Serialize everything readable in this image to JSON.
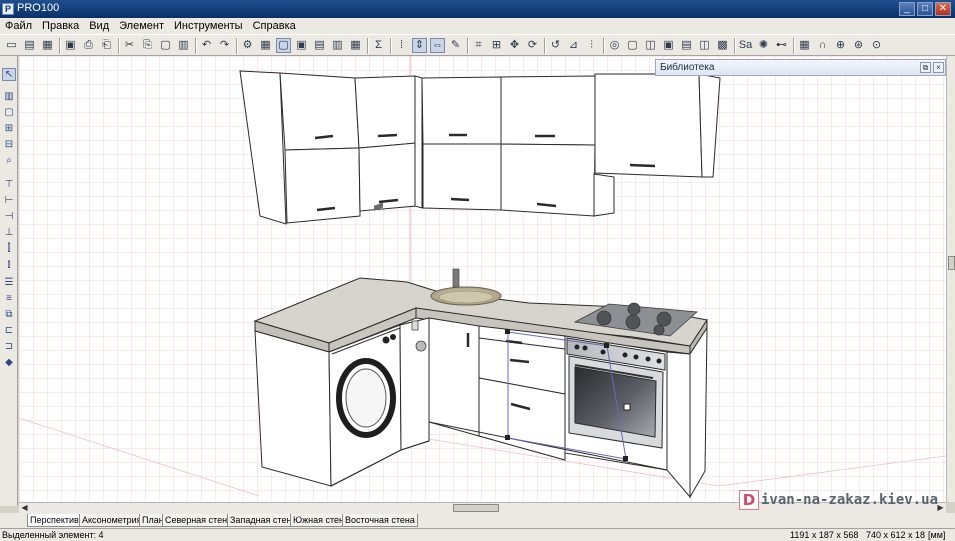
{
  "window": {
    "title": "PRO100",
    "app_icon": "pro100-app-icon"
  },
  "window_controls": {
    "minimize": "_",
    "maximize": "□",
    "close": "✕"
  },
  "menu": [
    "Файл",
    "Правка",
    "Вид",
    "Элемент",
    "Инструменты",
    "Справка"
  ],
  "toolbar_icons": [
    "new-icon",
    "open-icon",
    "save-icon",
    "export-icon",
    "print-icon",
    "print-preview-icon",
    "cut-icon",
    "copy-icon",
    "paste-icon",
    "clone-icon",
    "undo-icon",
    "redo-icon",
    "properties-icon",
    "sheet-icon",
    "view-mode-icon",
    "view-mode-2-icon",
    "view-mode-3-icon",
    "view-mode-4-icon",
    "view-mode-5-icon",
    "sum-icon",
    "snap-icon",
    "move-icon",
    "rotate-icon",
    "pen-icon",
    "frame-icon",
    "align-icon",
    "move-cross-icon",
    "rotate-axis-icon",
    "rotate-icon-2",
    "flip-icon",
    "mirror-icon",
    "target-icon",
    "cube-icon",
    "cube-2-icon",
    "cube-3-icon",
    "cube-4-icon",
    "cube-5-icon",
    "cube-6-icon",
    "texture-icon",
    "light-icon",
    "dimension-icon",
    "grid-icon",
    "magnet-icon",
    "render-icon",
    "lifebuoy-icon",
    "zoom-icon"
  ],
  "toolbar_glyphs": [
    "▭",
    "▤",
    "▦",
    "▣",
    "⎙",
    "⎗",
    "✂",
    "⎘",
    "▢",
    "▥",
    "↶",
    "↷",
    "⚙",
    "▦",
    "▢",
    "▣",
    "▤",
    "▥",
    "▦",
    "Σ",
    "⁞",
    "⇕",
    "⇔",
    "✎",
    "⌗",
    "⊞",
    "✥",
    "⟳",
    "↺",
    "⊿",
    "⫶",
    "◎",
    "▢",
    "◫",
    "▣",
    "▤",
    "◫",
    "▩",
    "Sa",
    "✺",
    "⊷",
    "▦",
    "∩",
    "⊕",
    "⊛",
    "⊙"
  ],
  "left_toolbar_icons": [
    "pointer-icon",
    "wall-icon",
    "select-icon",
    "layers-icon",
    "hierarchy-icon",
    "zoom-icon",
    "align-top-icon",
    "align-h-icon",
    "align-mid-icon",
    "align-bottom-icon",
    "stack-icon",
    "stack-2-icon",
    "distribute-icon",
    "distribute-2-icon",
    "distribute-3-icon",
    "distribute-4-icon",
    "distribute-5-icon",
    "paint-icon"
  ],
  "left_toolbar_glyphs": [
    "↖",
    "▥",
    "▢",
    "⊞",
    "⊟",
    "⌕",
    "⊤",
    "⊢",
    "⊣",
    "⊥",
    "⫿",
    "⫾",
    "☰",
    "≡",
    "⧉",
    "⊏",
    "⊐",
    "◆"
  ],
  "library": {
    "title": "Библиотека",
    "restore": "⧉",
    "close": "×"
  },
  "scrollbar": {
    "left_arrow": "◀",
    "right_arrow": "▶"
  },
  "tabs": [
    "Перспектива",
    "Аксонометрия",
    "План",
    "Северная стена",
    "Западная стена",
    "Южная стена",
    "Восточная стена"
  ],
  "active_tab": "Перспектива",
  "status": {
    "selected": "Выделенный элемент: 4",
    "dimensions": "1191 x 187 x 568",
    "room_size": "740 x 612 x 18",
    "units": "[мм]"
  },
  "watermark": {
    "logo": "D",
    "text": "ivan-na-zakaz.kiev.ua"
  },
  "colors": {
    "grid": "#f0c8cc",
    "countertop": "#d8d6cf",
    "cabinet": "#ffffff",
    "outline": "#2a2a2a",
    "selection": "#6a6ab8",
    "watermark_accent": "#d4486a"
  }
}
